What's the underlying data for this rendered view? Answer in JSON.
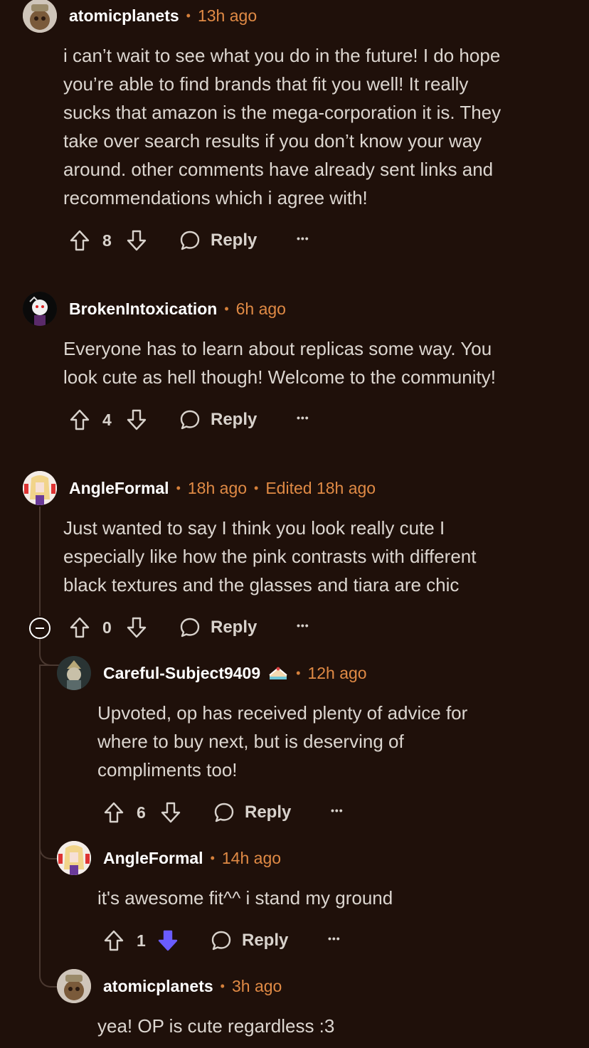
{
  "comments": [
    {
      "username": "atomicplanets",
      "time": "13h ago",
      "body": [
        "i can’t wait to see what you do in the future! I do hope",
        "you’re able to find brands that fit you well! It really",
        "sucks that amazon is the mega-corporation it is. They",
        "take over search results if you don’t know your way",
        "around. other comments have already sent links and",
        "recommendations which i agree with!"
      ],
      "votes": "8",
      "reply_label": "Reply",
      "more": "•••"
    },
    {
      "username": "BrokenIntoxication",
      "time": "6h ago",
      "body": [
        "Everyone has to learn about replicas some way. You",
        "look cute as hell though! Welcome to the community!"
      ],
      "votes": "4",
      "reply_label": "Reply",
      "more": "•••"
    },
    {
      "username": "AngleFormal",
      "time": "18h ago",
      "edited": "Edited 18h ago",
      "body": [
        "Just wanted to say I think you look really cute I",
        "especially like how the pink contrasts with different",
        "black textures and the glasses and tiara are chic"
      ],
      "votes": "0",
      "reply_label": "Reply",
      "more": "•••"
    },
    {
      "username": "Careful-Subject9409",
      "flair": "cake-icon",
      "time": "12h ago",
      "body": [
        "Upvoted, op has received plenty of advice for",
        "where to buy next, but is deserving of",
        "compliments too!"
      ],
      "votes": "6",
      "reply_label": "Reply",
      "more": "•••"
    },
    {
      "username": "AngleFormal",
      "time": "14h ago",
      "body": [
        "it's awesome fit^^ i stand my ground"
      ],
      "votes": "1",
      "downvoted": true,
      "reply_label": "Reply",
      "more": "•••"
    },
    {
      "username": "atomicplanets",
      "time": "3h ago",
      "body": [
        "yea! OP is cute regardless :3"
      ]
    }
  ],
  "colors": {
    "background": "#1f100a",
    "timestamp": "#e08a45",
    "downvote_active": "#6a5cff"
  }
}
